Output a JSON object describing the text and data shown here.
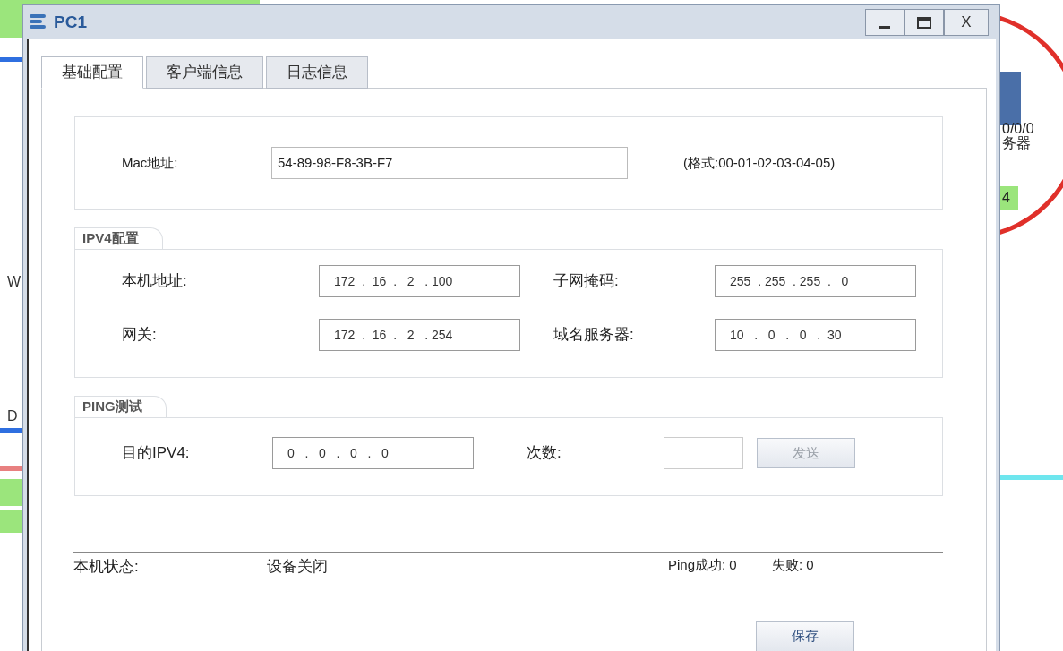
{
  "background": {
    "left_labels": [
      "W",
      "D"
    ],
    "right_labels": [
      "0/0/0",
      "务器",
      "4"
    ]
  },
  "window": {
    "title": "PC1",
    "close_label": "X"
  },
  "tabs": [
    {
      "label": "基础配置",
      "selected": true
    },
    {
      "label": "客户端信息",
      "selected": false
    },
    {
      "label": "日志信息",
      "selected": false
    }
  ],
  "mac": {
    "label": "Mac地址:",
    "value": "54-89-98-F8-3B-F7",
    "hint": "(格式:00-01-02-03-04-05)"
  },
  "ipv4": {
    "title": "IPV4配置",
    "fields": [
      {
        "label": "本机地址:",
        "value": "172  .  16  .   2   . 100"
      },
      {
        "label": "子网掩码:",
        "value": "255  . 255  . 255  .   0"
      },
      {
        "label": "网关:",
        "value": "172  .  16  .   2   . 254"
      },
      {
        "label": "域名服务器:",
        "value": "10   .   0   .   0   .  30"
      }
    ]
  },
  "ping": {
    "title": "PING测试",
    "target_label": "目的IPV4:",
    "target_value": "0   .   0   .   0   .   0",
    "count_label": "次数:",
    "send_button": {
      "label": "发送",
      "disabled": true
    }
  },
  "status": {
    "label": "本机状态:",
    "value": "设备关闭",
    "success": "Ping成功: 0",
    "failure": "失败: 0"
  },
  "save_button": {
    "label": "保存",
    "disabled": false
  }
}
